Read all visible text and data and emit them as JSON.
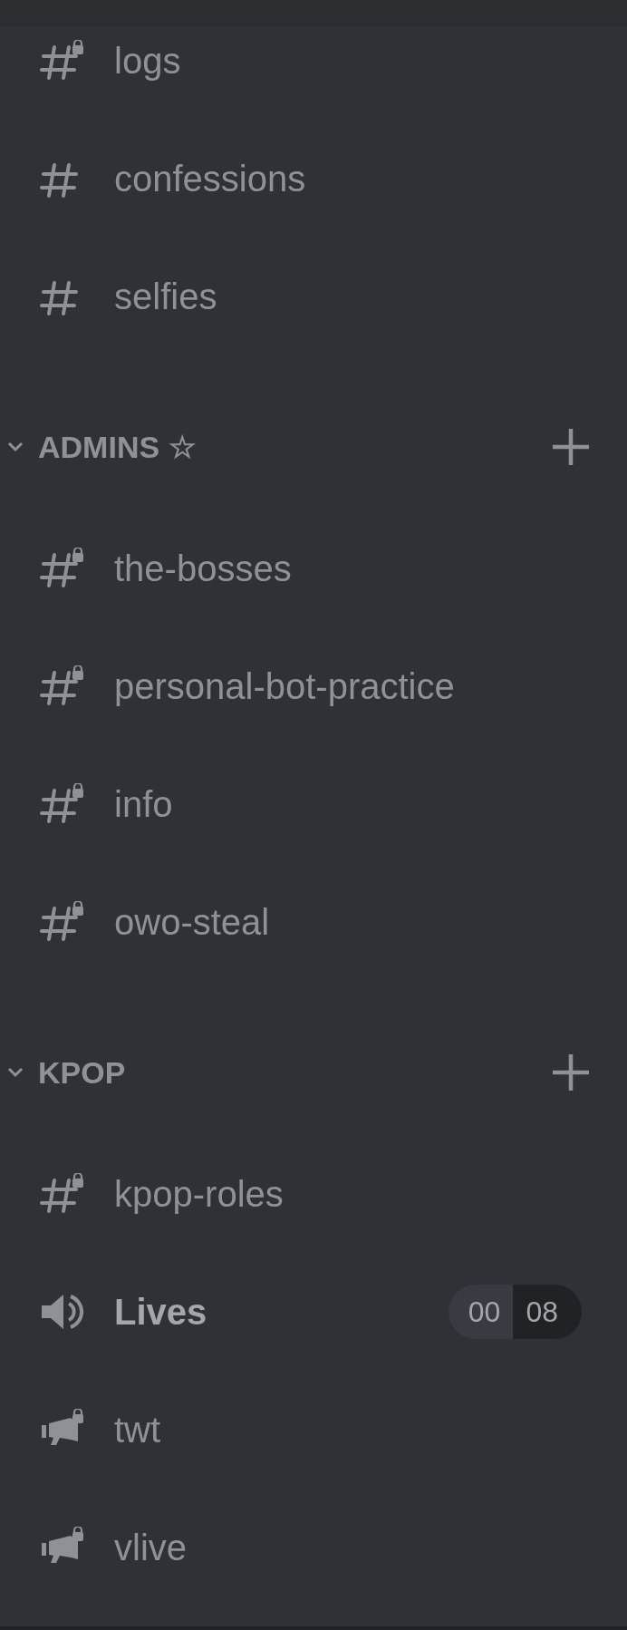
{
  "channels": [
    {
      "kind": "text-locked",
      "name": "logs",
      "unread": false
    },
    {
      "kind": "text",
      "name": "confessions",
      "unread": false
    },
    {
      "kind": "text",
      "name": "selfies",
      "unread": false
    }
  ],
  "categories": [
    {
      "name": "ADMINS ☆",
      "expanded": true,
      "channels": [
        {
          "kind": "text-locked",
          "name": "the-bosses",
          "unread": false
        },
        {
          "kind": "text-locked",
          "name": "personal-bot-practice",
          "unread": false
        },
        {
          "kind": "text-locked",
          "name": "info",
          "unread": false
        },
        {
          "kind": "text-locked",
          "name": "owo-steal",
          "unread": false
        }
      ]
    },
    {
      "name": "KPOP",
      "expanded": true,
      "channels": [
        {
          "kind": "text-locked",
          "name": "kpop-roles",
          "unread": false
        },
        {
          "kind": "voice",
          "name": "Lives",
          "unread": true,
          "users": "00",
          "limit": "08"
        },
        {
          "kind": "announcement-locked",
          "name": "twt",
          "unread": false
        },
        {
          "kind": "announcement-locked",
          "name": "vlive",
          "unread": false
        }
      ]
    }
  ]
}
